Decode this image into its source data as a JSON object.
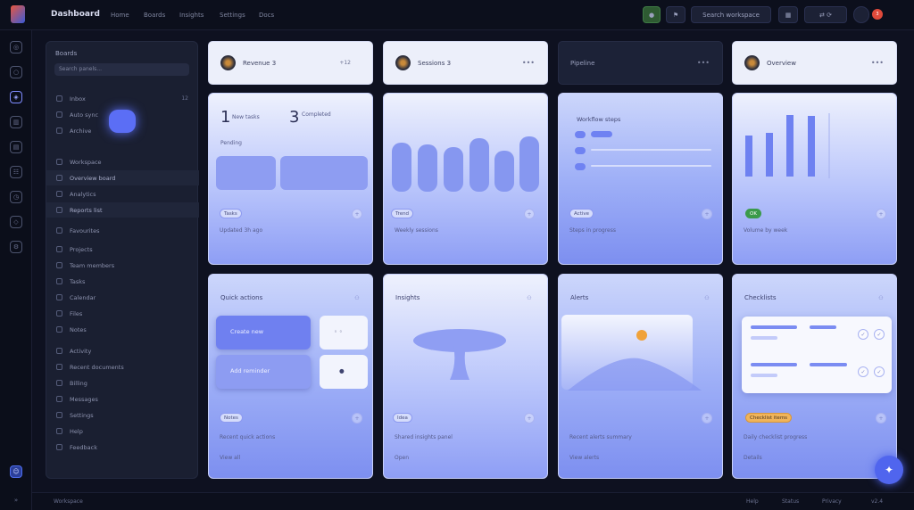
{
  "header": {
    "brand": "Dashboard",
    "nav": [
      "Home",
      "Boards",
      "Insights",
      "Settings",
      "Docs"
    ],
    "actions": {
      "status": "live",
      "filter": "filter",
      "search_label": "Search workspace",
      "grid": "grid",
      "notify": "3"
    }
  },
  "sidebar": {
    "title": "Boards",
    "search_placeholder": "Search panels...",
    "items": [
      {
        "label": "Inbox",
        "value": "12"
      },
      {
        "label": "Auto sync",
        "value": ""
      },
      {
        "label": "Archive",
        "value": ""
      },
      {
        "label": "Workspace",
        "value": ""
      },
      {
        "label": "Overview board",
        "value": ""
      },
      {
        "label": "Analytics",
        "value": ""
      },
      {
        "label": "Reports list",
        "value": ""
      },
      {
        "label": "Favourites",
        "value": ""
      },
      {
        "label": "Projects",
        "value": ""
      },
      {
        "label": "Team members",
        "value": ""
      },
      {
        "label": "Tasks",
        "value": ""
      },
      {
        "label": "Calendar",
        "value": ""
      },
      {
        "label": "Files",
        "value": ""
      },
      {
        "label": "Notes",
        "value": ""
      },
      {
        "label": "Activity",
        "value": ""
      },
      {
        "label": "Recent documents",
        "value": ""
      },
      {
        "label": "Billing",
        "value": ""
      },
      {
        "label": "Messages",
        "value": ""
      },
      {
        "label": "Settings",
        "value": ""
      },
      {
        "label": "Help",
        "value": ""
      },
      {
        "label": "Feedback",
        "value": ""
      }
    ]
  },
  "cards": {
    "headers": [
      {
        "title": "Revenue 3",
        "meta": "+12"
      },
      {
        "title": "Sessions 3"
      },
      {
        "title": "Pipeline"
      },
      {
        "title": "Overview"
      }
    ],
    "card1": {
      "stat1": "1",
      "stat1_label": "New tasks",
      "stat2": "3",
      "stat2_label": "Completed",
      "sub": "Pending",
      "chip": "Tasks",
      "foot": "Updated 3h ago"
    },
    "card2": {
      "chip": "Trend",
      "foot": "Weekly sessions"
    },
    "card3": {
      "title": "Workflow steps",
      "chip": "Active",
      "foot": "Steps in progress"
    },
    "card4": {
      "chip": "OK",
      "foot": "Volume by week"
    },
    "card5": {
      "title": "Quick actions",
      "btn1": "Create new",
      "btn2": "Add reminder",
      "chip": "Notes",
      "foot": "Recent quick actions",
      "link": "View all"
    },
    "card6": {
      "title": "Insights",
      "chip": "Idea",
      "foot": "Shared insights panel",
      "link": "Open"
    },
    "card7": {
      "title": "Alerts",
      "foot": "Recent alerts summary",
      "link": "View alerts"
    },
    "card8": {
      "title": "Checklists",
      "chip": "Checklist items",
      "foot": "Daily checklist progress",
      "link": "Details"
    }
  },
  "footer": {
    "left": "Workspace",
    "right": [
      "Help",
      "Status",
      "Privacy",
      "v2.4"
    ]
  },
  "colors": {
    "accent": "#5b6ef5",
    "bg": "#0e1120",
    "card": "#eef1fd"
  }
}
